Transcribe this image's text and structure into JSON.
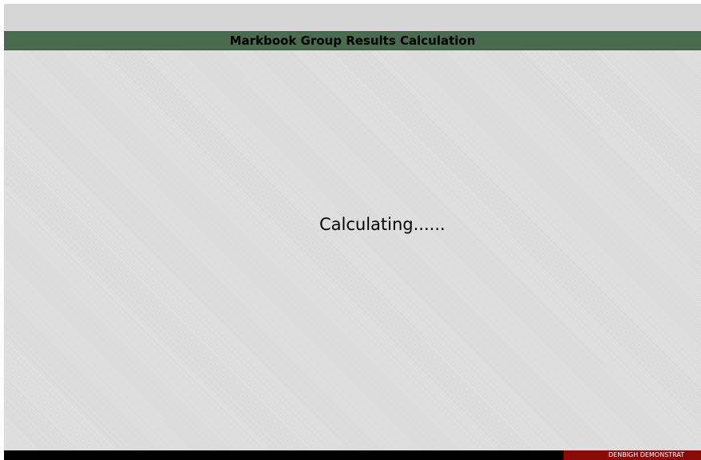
{
  "header": {
    "title": "Markbook Group Results Calculation"
  },
  "main": {
    "status_text": "Calculating......"
  },
  "footer": {
    "badge_text": "DENBIGH DEMONSTRAT"
  },
  "colors": {
    "title_bar": "#4a6b4e",
    "background": "#dcdcdc",
    "footer": "#000000",
    "badge": "#8b0a0a"
  }
}
